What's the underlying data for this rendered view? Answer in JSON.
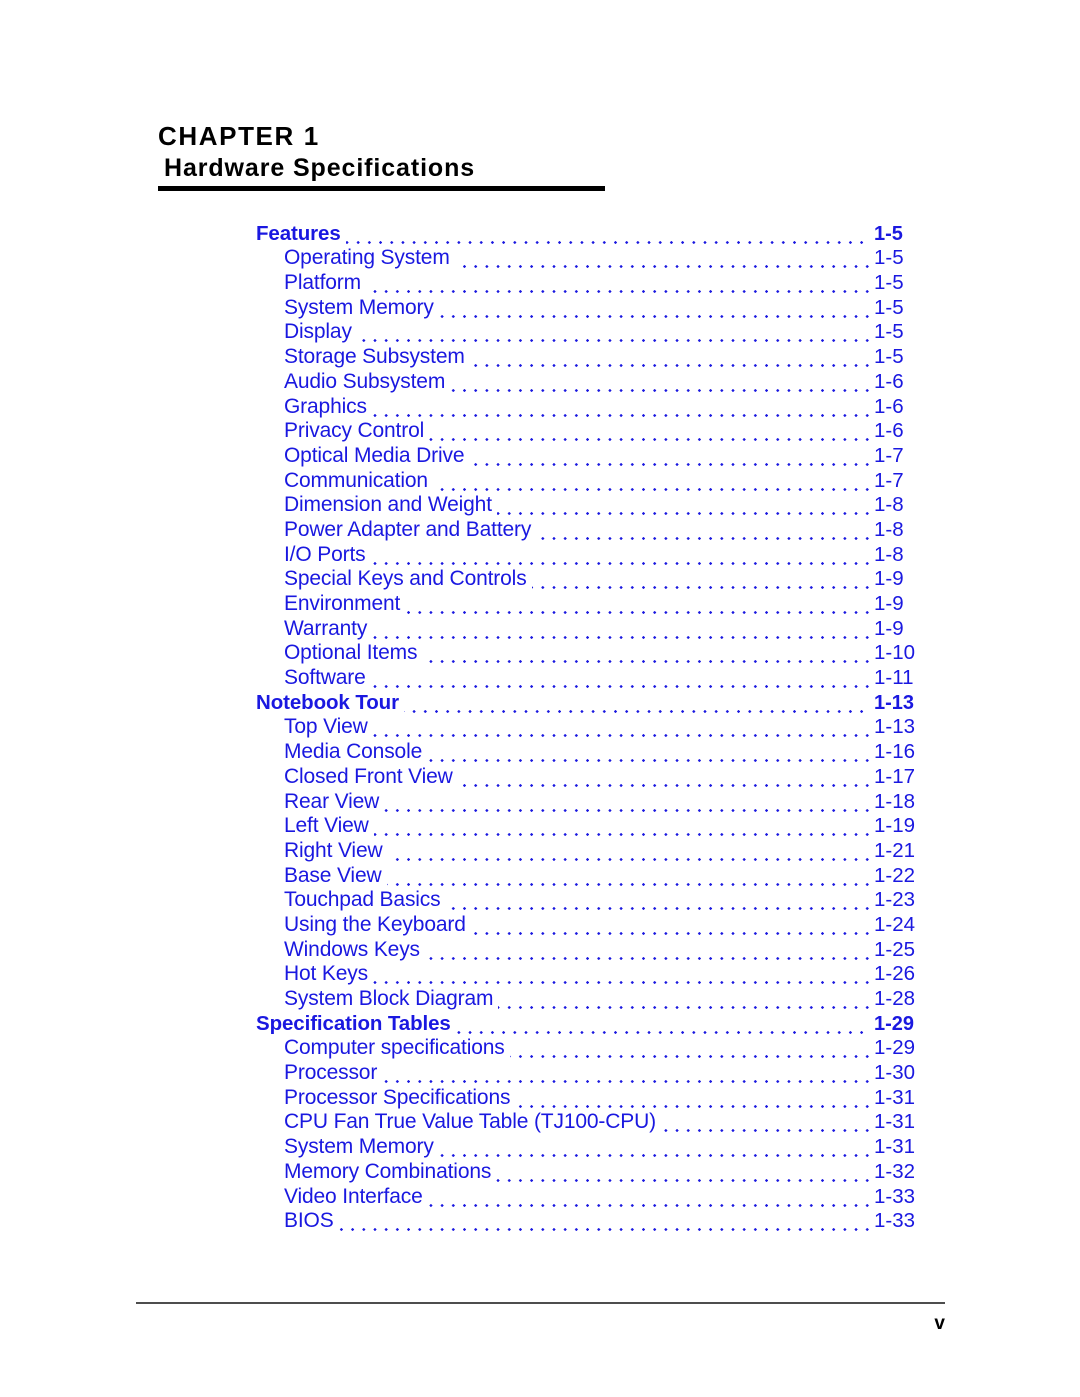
{
  "chapter": {
    "label": "CHAPTER 1",
    "title": "Hardware Specifications"
  },
  "colors": {
    "toc_link": "#1a18e0",
    "rule": "#000000",
    "footer_rule": "#4d4d4d",
    "text": "#000000"
  },
  "toc": {
    "rows": [
      {
        "level": "section",
        "label": "Features",
        "page": "1-5"
      },
      {
        "level": "entry",
        "label": "Operating System",
        "page": "1-5"
      },
      {
        "level": "entry",
        "label": "Platform",
        "page": "1-5"
      },
      {
        "level": "entry",
        "label": "System Memory",
        "page": "1-5"
      },
      {
        "level": "entry",
        "label": "Display",
        "page": "1-5"
      },
      {
        "level": "entry",
        "label": "Storage Subsystem",
        "page": "1-5"
      },
      {
        "level": "entry",
        "label": "Audio Subsystem",
        "page": "1-6"
      },
      {
        "level": "entry",
        "label": "Graphics",
        "page": "1-6"
      },
      {
        "level": "entry",
        "label": "Privacy Control",
        "page": "1-6"
      },
      {
        "level": "entry",
        "label": "Optical Media Drive",
        "page": "1-7"
      },
      {
        "level": "entry",
        "label": "Communication",
        "page": "1-7"
      },
      {
        "level": "entry",
        "label": "Dimension and Weight",
        "page": "1-8"
      },
      {
        "level": "entry",
        "label": "Power Adapter and Battery",
        "page": "1-8"
      },
      {
        "level": "entry",
        "label": "I/O Ports",
        "page": "1-8"
      },
      {
        "level": "entry",
        "label": "Special Keys and Controls",
        "page": "1-9"
      },
      {
        "level": "entry",
        "label": "Environment",
        "page": "1-9"
      },
      {
        "level": "entry",
        "label": "Warranty",
        "page": "1-9"
      },
      {
        "level": "entry",
        "label": "Optional Items",
        "page": "1-10"
      },
      {
        "level": "entry",
        "label": "Software",
        "page": "1-11"
      },
      {
        "level": "section",
        "label": "Notebook Tour",
        "page": "1-13"
      },
      {
        "level": "entry",
        "label": "Top View",
        "page": "1-13"
      },
      {
        "level": "entry",
        "label": "Media Console",
        "page": "1-16"
      },
      {
        "level": "entry",
        "label": "Closed Front View",
        "page": "1-17"
      },
      {
        "level": "entry",
        "label": "Rear View",
        "page": "1-18"
      },
      {
        "level": "entry",
        "label": "Left View",
        "page": "1-19"
      },
      {
        "level": "entry",
        "label": "Right View",
        "page": "1-21"
      },
      {
        "level": "entry",
        "label": "Base View",
        "page": "1-22"
      },
      {
        "level": "entry",
        "label": "Touchpad Basics",
        "page": "1-23"
      },
      {
        "level": "entry",
        "label": "Using the Keyboard",
        "page": "1-24"
      },
      {
        "level": "entry",
        "label": "Windows Keys",
        "page": "1-25"
      },
      {
        "level": "entry",
        "label": "Hot Keys",
        "page": "1-26"
      },
      {
        "level": "entry",
        "label": "System Block Diagram",
        "page": "1-28"
      },
      {
        "level": "section",
        "label": "Specification Tables",
        "page": "1-29"
      },
      {
        "level": "entry",
        "label": "Computer specifications",
        "page": "1-29"
      },
      {
        "level": "entry",
        "label": "Processor",
        "page": "1-30"
      },
      {
        "level": "entry",
        "label": "Processor Specifications",
        "page": "1-31"
      },
      {
        "level": "entry",
        "label": "CPU Fan True Value Table (TJ100-CPU)",
        "page": "1-31"
      },
      {
        "level": "entry",
        "label": "System Memory",
        "page": "1-31"
      },
      {
        "level": "entry",
        "label": "Memory Combinations",
        "page": "1-32"
      },
      {
        "level": "entry",
        "label": "Video Interface",
        "page": "1-33"
      },
      {
        "level": "entry",
        "label": "BIOS",
        "page": "1-33"
      }
    ]
  },
  "footer": {
    "page_number": "v"
  }
}
